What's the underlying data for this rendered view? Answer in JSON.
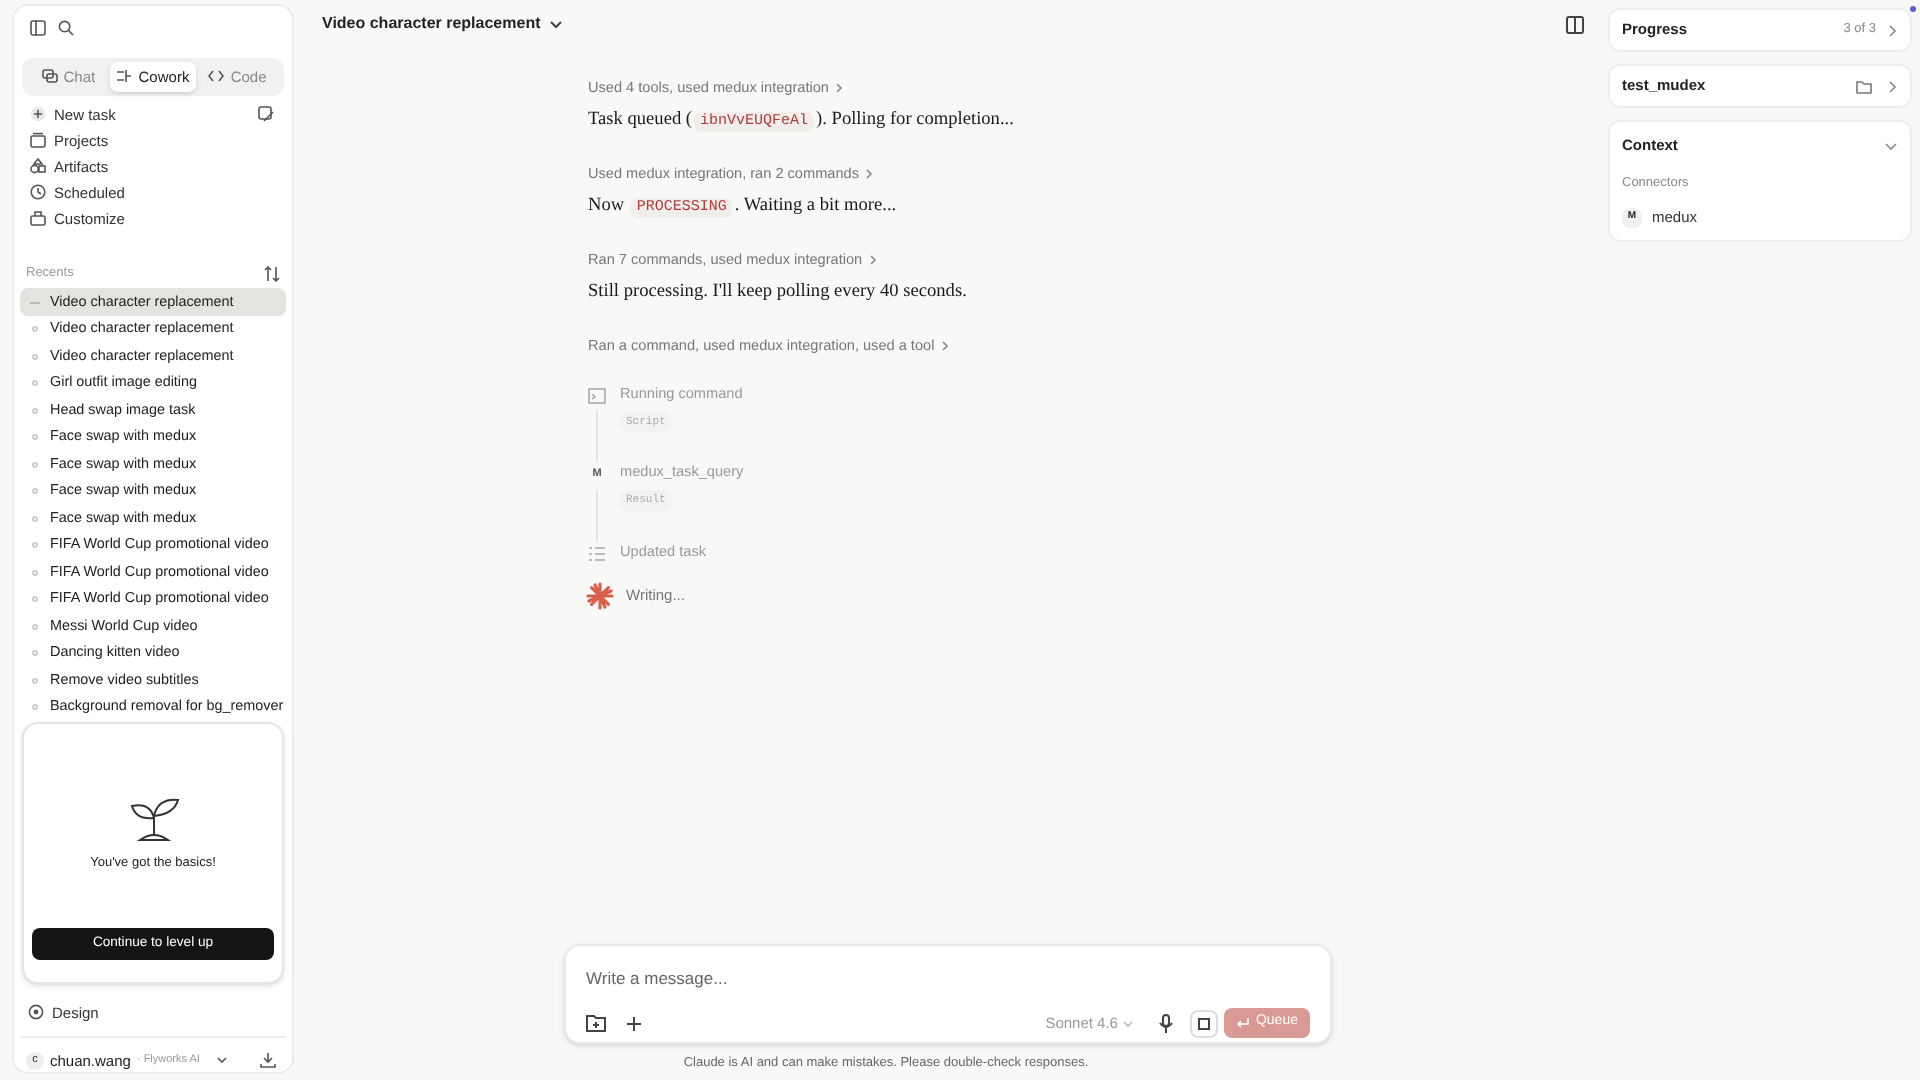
{
  "sidebar": {
    "tabs": [
      {
        "label": "Chat",
        "selected": false
      },
      {
        "label": "Cowork",
        "selected": true
      },
      {
        "label": "Code",
        "selected": false
      }
    ],
    "nav": [
      {
        "label": "New task",
        "kind": "plus"
      },
      {
        "label": "Projects",
        "kind": "box"
      },
      {
        "label": "Artifacts",
        "kind": "shapes"
      },
      {
        "label": "Scheduled",
        "kind": "clock"
      },
      {
        "label": "Customize",
        "kind": "bag"
      }
    ],
    "recents_label": "Recents",
    "recents": [
      {
        "label": "Video character replacement",
        "selected": true
      },
      {
        "label": "Video character replacement",
        "selected": false
      },
      {
        "label": "Video character replacement",
        "selected": false
      },
      {
        "label": "Girl outfit image editing",
        "selected": false
      },
      {
        "label": "Head swap image task",
        "selected": false
      },
      {
        "label": "Face swap with medux",
        "selected": false
      },
      {
        "label": "Face swap with medux",
        "selected": false
      },
      {
        "label": "Face swap with medux",
        "selected": false
      },
      {
        "label": "Face swap with medux",
        "selected": false
      },
      {
        "label": "FIFA World Cup promotional video",
        "selected": false
      },
      {
        "label": "FIFA World Cup promotional video",
        "selected": false
      },
      {
        "label": "FIFA World Cup promotional video",
        "selected": false
      },
      {
        "label": "Messi World Cup video",
        "selected": false
      },
      {
        "label": "Dancing kitten video",
        "selected": false
      },
      {
        "label": "Remove video subtitles",
        "selected": false
      },
      {
        "label": "Background removal for bg_remover",
        "selected": false
      }
    ],
    "promo": {
      "text": "You've got the basics!",
      "button": "Continue to level up"
    },
    "design": "Design",
    "user": {
      "avatar": "c",
      "name": "chuan.wang",
      "org": "· Flyworks AI"
    }
  },
  "header": {
    "title": "Video character replacement"
  },
  "conversation": [
    {
      "kind": "summary",
      "text": "Used 4 tools, used medux integration"
    },
    {
      "kind": "message",
      "parts": [
        {
          "kind": "text",
          "text": "Task queued ("
        },
        {
          "kind": "code",
          "text": "ibnVvEUQFeAl"
        },
        {
          "kind": "text",
          "text": "). Polling for completion..."
        }
      ]
    },
    {
      "kind": "summary",
      "text": "Used medux integration, ran 2 commands"
    },
    {
      "kind": "message",
      "parts": [
        {
          "kind": "text",
          "text": "Now "
        },
        {
          "kind": "code",
          "text": "PROCESSING"
        },
        {
          "kind": "text",
          "text": ". Waiting a bit more..."
        }
      ]
    },
    {
      "kind": "summary",
      "text": "Ran 7 commands, used medux integration"
    },
    {
      "kind": "message",
      "parts": [
        {
          "kind": "text",
          "text": "Still processing. I'll keep polling every 40 seconds."
        }
      ]
    },
    {
      "kind": "summary",
      "text": "Ran a command, used medux integration, used a tool"
    }
  ],
  "activity": [
    {
      "kind": "terminal",
      "label": "Running command",
      "tag": "Script"
    },
    {
      "kind": "letter",
      "letter": "M",
      "label": "medux_task_query",
      "tag": "Result"
    },
    {
      "kind": "list",
      "label": "Updated task"
    }
  ],
  "writing": "Writing...",
  "composer": {
    "placeholder": "Write a message...",
    "model": "Sonnet 4.6",
    "send": "Queue"
  },
  "disclaimer": "Claude is AI and can make mistakes. Please double-check responses.",
  "right_panel": {
    "progress": {
      "title": "Progress",
      "count": "3 of 3"
    },
    "folder": {
      "title": "test_mudex"
    },
    "context": {
      "title": "Context",
      "section": "Connectors",
      "connectors": [
        {
          "letter": "M",
          "name": "medux"
        }
      ]
    }
  }
}
